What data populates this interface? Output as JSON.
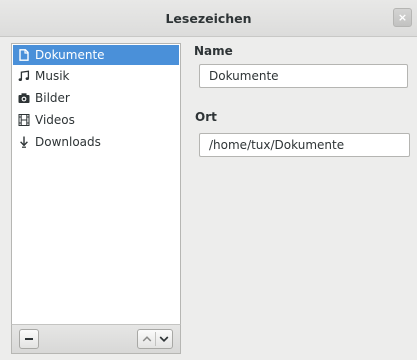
{
  "window": {
    "title": "Lesezeichen",
    "close_label": "×"
  },
  "sidebar": {
    "items": [
      {
        "label": "Dokumente",
        "icon": "document-icon",
        "selected": true
      },
      {
        "label": "Musik",
        "icon": "music-icon",
        "selected": false
      },
      {
        "label": "Bilder",
        "icon": "camera-icon",
        "selected": false
      },
      {
        "label": "Videos",
        "icon": "film-icon",
        "selected": false
      },
      {
        "label": "Downloads",
        "icon": "download-icon",
        "selected": false
      }
    ]
  },
  "toolbar": {
    "remove_icon": "minus-icon",
    "move_up_icon": "chevron-up-icon",
    "move_down_icon": "chevron-down-icon"
  },
  "details": {
    "name_label": "Name",
    "name_value": "Dokumente",
    "location_label": "Ort",
    "location_value": "/home/tux/Dokumente"
  },
  "colors": {
    "selection": "#4a90d9",
    "background": "#ededec"
  }
}
